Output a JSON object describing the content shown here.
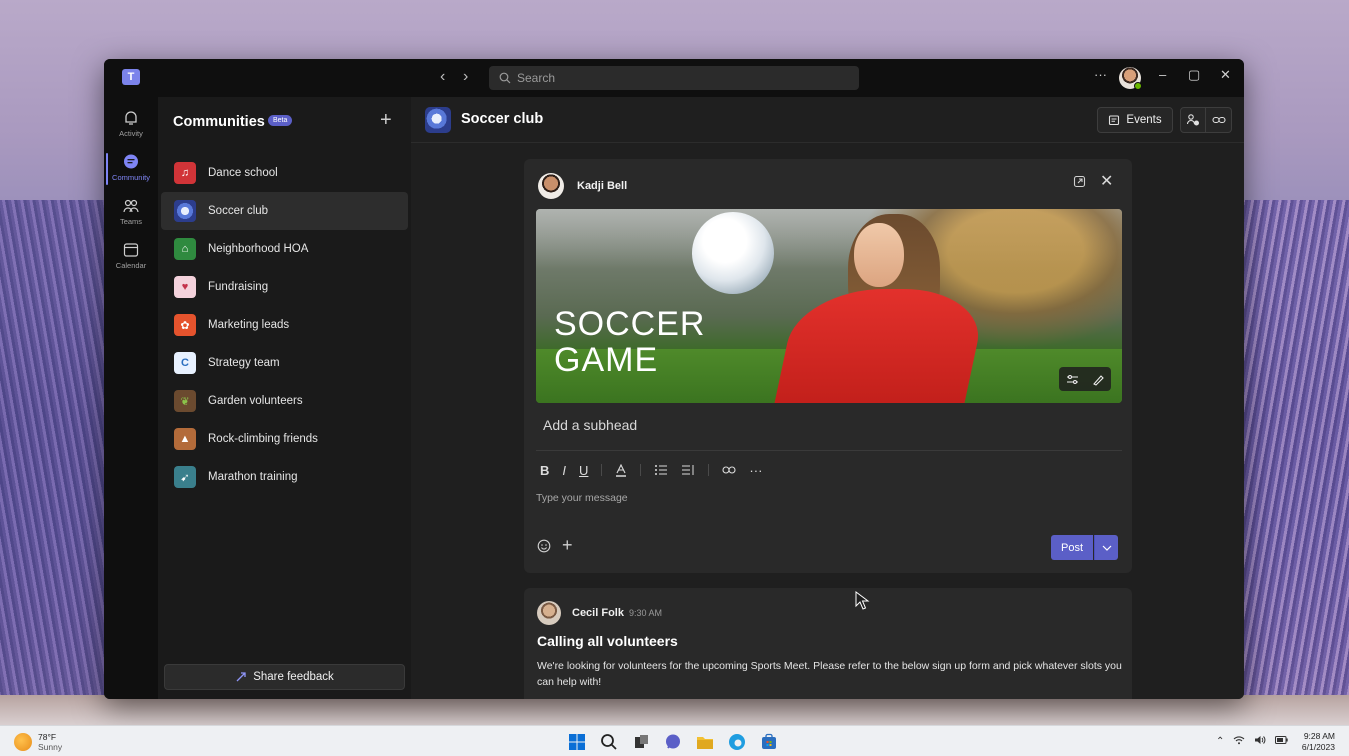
{
  "titlebar": {
    "search_placeholder": "Search",
    "more_label": "···",
    "minimize": "–",
    "maximize": "▢",
    "close": "✕"
  },
  "rail": [
    {
      "label": "Activity",
      "icon": "bell-icon"
    },
    {
      "label": "Community",
      "icon": "community-icon",
      "active": true
    },
    {
      "label": "Teams",
      "icon": "teams-icon"
    },
    {
      "label": "Calendar",
      "icon": "calendar-icon"
    }
  ],
  "sidebar": {
    "title": "Communities",
    "badge": "Beta",
    "add_label": "+",
    "items": [
      {
        "label": "Dance school",
        "color": "#d13438"
      },
      {
        "label": "Soccer club",
        "color": "#3b5bb5",
        "active": true
      },
      {
        "label": "Neighborhood HOA",
        "color": "#2f8a3f"
      },
      {
        "label": "Fundraising",
        "color": "#c4314b"
      },
      {
        "label": "Marketing leads",
        "color": "#e5532d"
      },
      {
        "label": "Strategy team",
        "color": "#e8f1ff"
      },
      {
        "label": "Garden volunteers",
        "color": "#6b4a2f"
      },
      {
        "label": "Rock-climbing friends",
        "color": "#b36b3a"
      },
      {
        "label": "Marathon training",
        "color": "#3a7f8c"
      }
    ],
    "feedback_label": "Share feedback"
  },
  "channel": {
    "title": "Soccer club",
    "events_label": "Events"
  },
  "compose": {
    "author": "Kadji Bell",
    "hero_line1": "SOCCER",
    "hero_line2": "GAME",
    "subhead_placeholder": "Add a subhead",
    "message_placeholder": "Type your message",
    "post_label": "Post",
    "format": [
      "B",
      "I",
      "U"
    ]
  },
  "post": {
    "author": "Cecil Folk",
    "time": "9:30 AM",
    "title": "Calling all volunteers",
    "body": "We're looking for volunteers for the upcoming Sports Meet. Please refer to the below sign up form and pick whatever slots you can help with!"
  },
  "taskbar": {
    "temp": "78°F",
    "condition": "Sunny",
    "time": "9:28 AM",
    "date": "6/1/2023"
  },
  "colors": {
    "accent": "#5b5fc7",
    "rail_accent": "#7f85f5",
    "presence": "#6bb700"
  }
}
